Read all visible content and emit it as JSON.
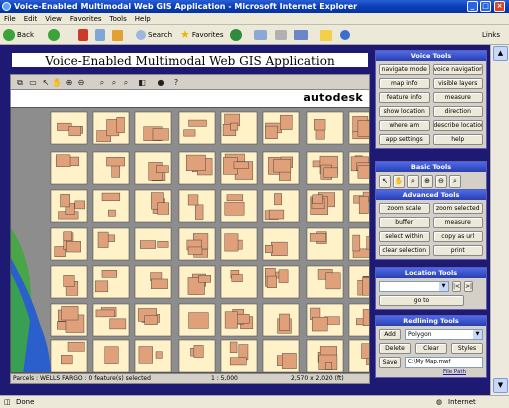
{
  "window": {
    "title": "Voice-Enabled Multimodal Web GIS Application - Microsoft Internet Explorer",
    "controls": [
      "_",
      "□",
      "×"
    ]
  },
  "menu": [
    "File",
    "Edit",
    "View",
    "Favorites",
    "Tools",
    "Help"
  ],
  "toolbar": {
    "back": "Back",
    "search": "Search",
    "favorites": "Favorites",
    "links": "Links"
  },
  "app": {
    "title": "Voice-Enabled Multimodal Web GIS Application",
    "brand": "autodesk"
  },
  "map_status": {
    "layer": "Parcels : WELLS FARGO : 0 feature(s) selected",
    "scale": "1 : 5,000",
    "size": "2,570 x 2,020 (ft)"
  },
  "panels": {
    "voice": {
      "title": "Voice Tools",
      "buttons": [
        "navigate mode",
        "voice navigation",
        "map info",
        "visible layers",
        "feature info",
        "measure",
        "show location",
        "direction",
        "where am",
        "describe location",
        "app settings",
        "help"
      ]
    },
    "basic": {
      "title": "Basic Tools",
      "icons": [
        "↖",
        "✋",
        "⌕",
        "⊕",
        "⊖",
        "⌕"
      ]
    },
    "advanced": {
      "title": "Advanced Tools",
      "buttons": [
        "zoom scale",
        "zoom selected",
        "buffer",
        "measure",
        "select within",
        "copy as url",
        "clear selection",
        "print"
      ]
    },
    "location": {
      "title": "Location Tools",
      "select_value": "",
      "goto": "go to"
    },
    "redlining": {
      "title": "Redlining Tools",
      "add": "Add",
      "type": "Polygon",
      "delete": "Delete",
      "clear": "Clear",
      "styles": "Styles",
      "save": "Save",
      "path": "C:\\My Map.mwf",
      "file_path": "File Path"
    }
  },
  "status": {
    "left": "Done",
    "zone": "Internet"
  },
  "colors": {
    "titlebar": "#0a3fb8",
    "stage": "#1e1a73",
    "panel_head": "#3a55d0",
    "map_block": "#fff2c8",
    "map_building": "#e0a07a",
    "map_street": "#8d8d8d",
    "map_water": "#2b5fcc",
    "map_green": "#3caa3c"
  }
}
